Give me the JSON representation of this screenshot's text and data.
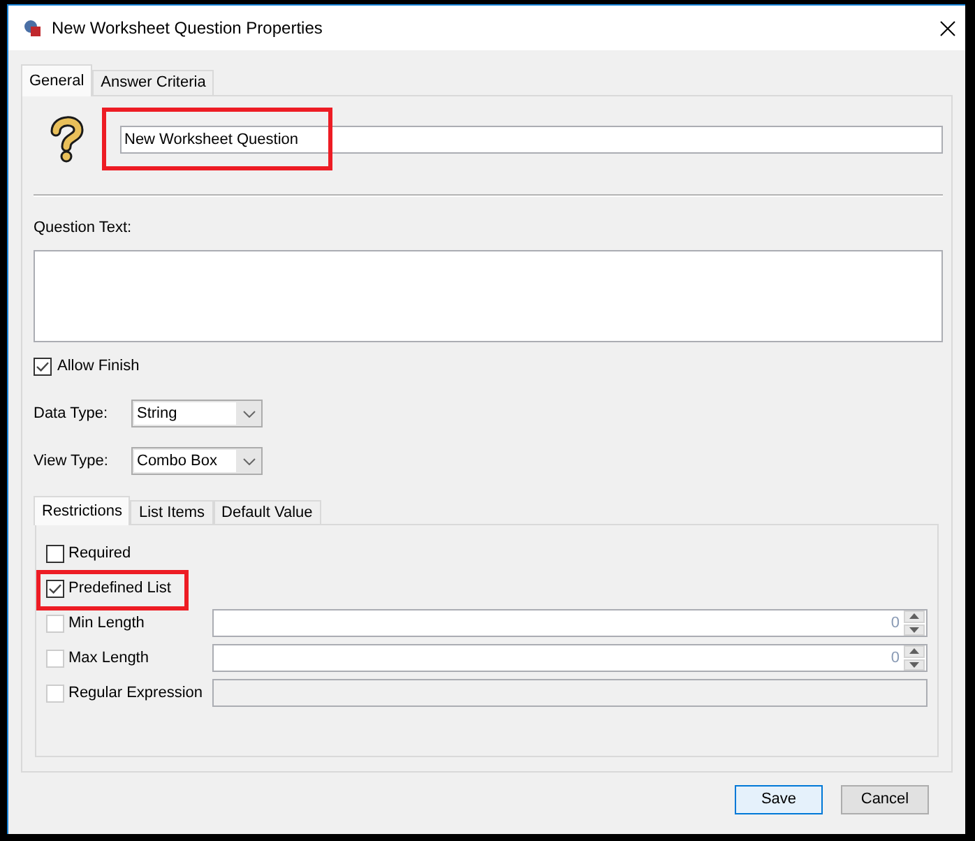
{
  "window": {
    "title": "New Worksheet Question Properties"
  },
  "tabs": [
    {
      "label": "General",
      "selected": true
    },
    {
      "label": "Answer Criteria",
      "selected": false
    }
  ],
  "name_field": {
    "value": "New Worksheet Question",
    "highlighted": true
  },
  "question_text": {
    "label": "Question Text:"
  },
  "allow_finish": {
    "label": "Allow Finish",
    "checked": true
  },
  "dropdowns": [
    {
      "label": "Data Type:",
      "value": "String"
    },
    {
      "label": "View Type:",
      "value": "Combo Box"
    }
  ],
  "sub_tabs": [
    {
      "label": "Restrictions",
      "selected": true
    },
    {
      "label": "List Items",
      "selected": false
    },
    {
      "label": "Default Value",
      "selected": false
    }
  ],
  "restrictions": [
    {
      "kind": "checkbox",
      "label": "Required",
      "checked": false,
      "disabled": false,
      "highlighted": false
    },
    {
      "kind": "checkbox",
      "label": "Predefined List",
      "checked": true,
      "disabled": false,
      "highlighted": true
    },
    {
      "kind": "spinner",
      "label": "Min Length",
      "checked": false,
      "disabled": true,
      "highlighted": false,
      "value": "0"
    },
    {
      "kind": "spinner",
      "label": "Max Length",
      "checked": false,
      "disabled": true,
      "highlighted": false,
      "value": "0"
    },
    {
      "kind": "text",
      "label": "Regular Expression",
      "checked": false,
      "disabled": true,
      "highlighted": false
    }
  ],
  "buttons": [
    {
      "label": "Save",
      "default": true
    },
    {
      "label": "Cancel",
      "default": false
    }
  ]
}
